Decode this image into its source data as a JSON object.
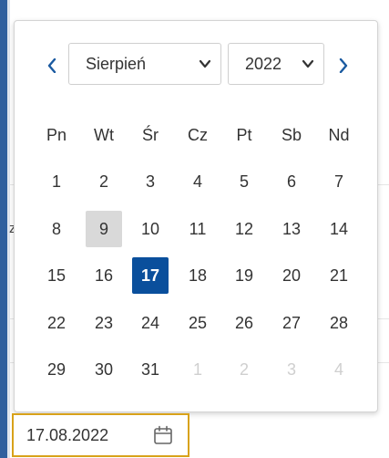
{
  "datepicker": {
    "prev_icon": "chevron-left-icon",
    "next_icon": "chevron-right-icon",
    "month_select": {
      "value": "Sierpień"
    },
    "year_select": {
      "value": "2022"
    },
    "weekdays": [
      "Pn",
      "Wt",
      "Śr",
      "Cz",
      "Pt",
      "Sb",
      "Nd"
    ],
    "weeks": [
      [
        {
          "d": "1"
        },
        {
          "d": "2"
        },
        {
          "d": "3"
        },
        {
          "d": "4"
        },
        {
          "d": "5"
        },
        {
          "d": "6"
        },
        {
          "d": "7"
        }
      ],
      [
        {
          "d": "8"
        },
        {
          "d": "9",
          "state": "today"
        },
        {
          "d": "10"
        },
        {
          "d": "11"
        },
        {
          "d": "12"
        },
        {
          "d": "13"
        },
        {
          "d": "14"
        }
      ],
      [
        {
          "d": "15"
        },
        {
          "d": "16"
        },
        {
          "d": "17",
          "state": "selected"
        },
        {
          "d": "18"
        },
        {
          "d": "19"
        },
        {
          "d": "20"
        },
        {
          "d": "21"
        }
      ],
      [
        {
          "d": "22"
        },
        {
          "d": "23"
        },
        {
          "d": "24"
        },
        {
          "d": "25"
        },
        {
          "d": "26"
        },
        {
          "d": "27"
        },
        {
          "d": "28"
        }
      ],
      [
        {
          "d": "29"
        },
        {
          "d": "30"
        },
        {
          "d": "31"
        },
        {
          "d": "1",
          "state": "other"
        },
        {
          "d": "2",
          "state": "other"
        },
        {
          "d": "3",
          "state": "other"
        },
        {
          "d": "4",
          "state": "other"
        }
      ]
    ]
  },
  "date_input": {
    "value": "17.08.2022",
    "icon": "calendar-icon",
    "border_color": "#d8a21a"
  },
  "background": {
    "partial_text": "z"
  },
  "colors": {
    "selected": "#0a4f9c",
    "today": "#d9d9d9",
    "nav": "#1a5aa0",
    "other_month": "#cfcfcf"
  }
}
